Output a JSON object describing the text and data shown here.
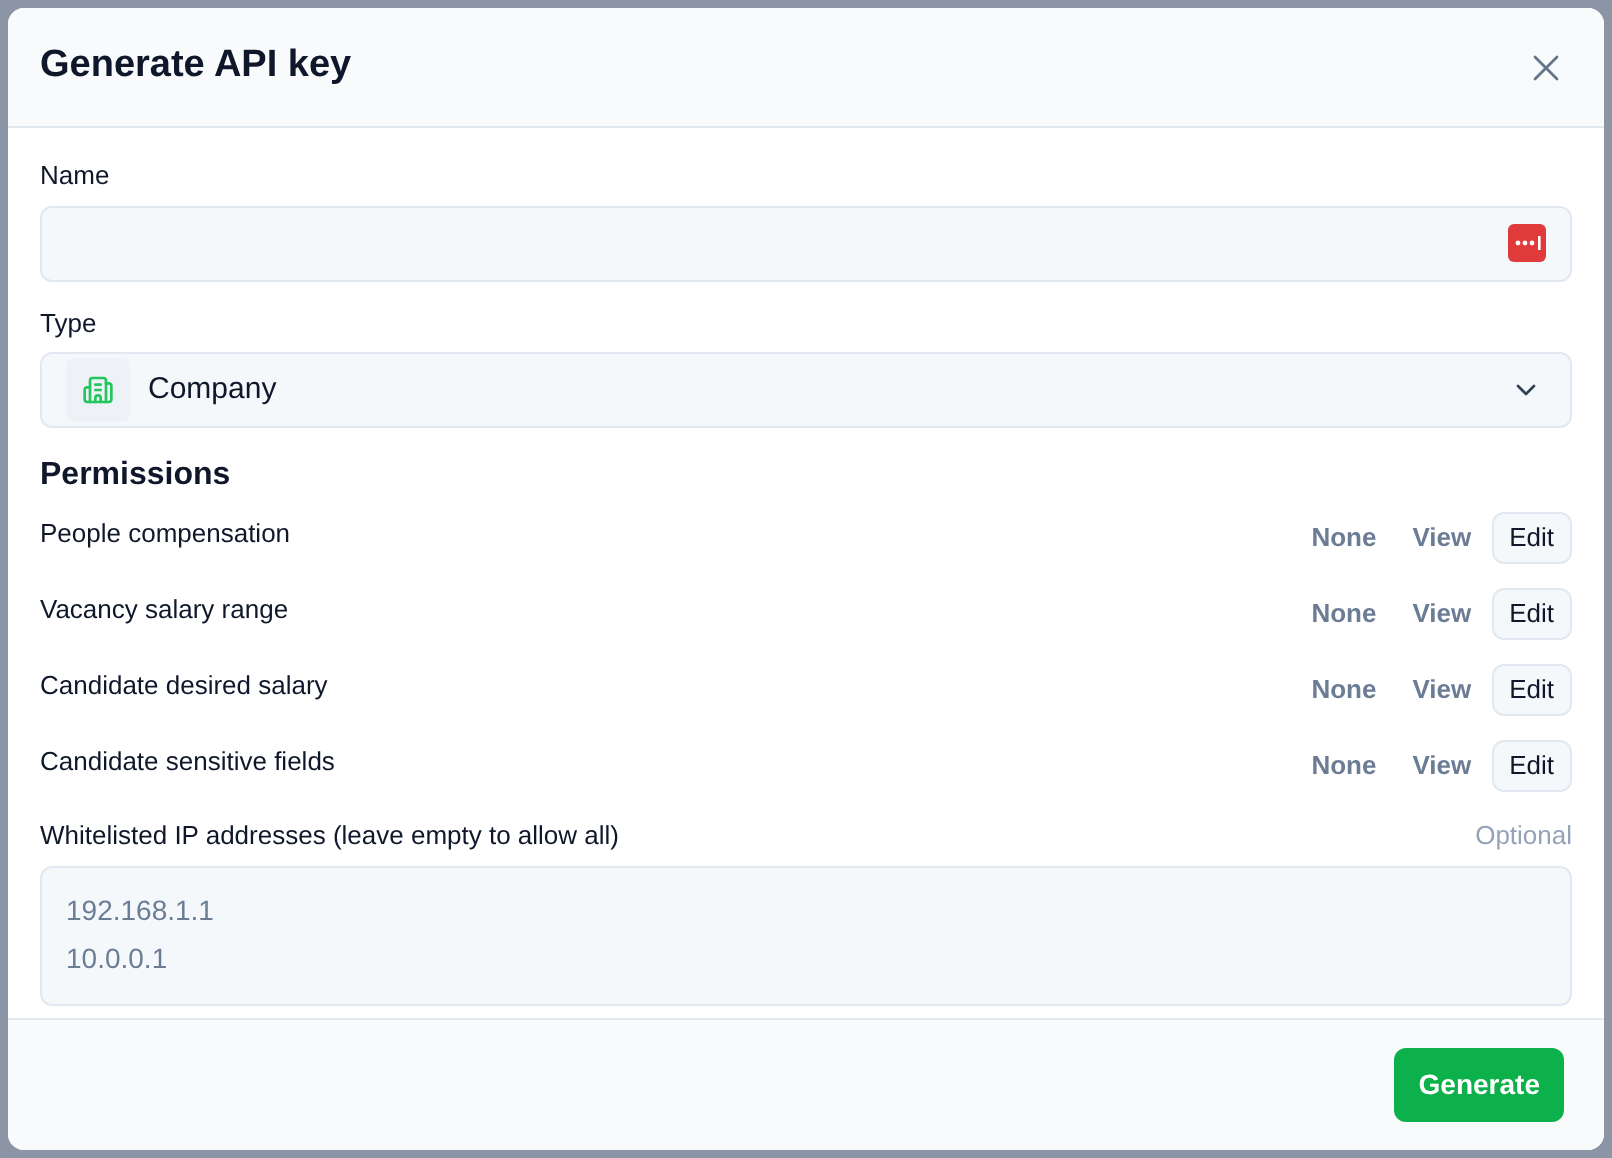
{
  "dialog": {
    "title": "Generate API key"
  },
  "name_field": {
    "label": "Name"
  },
  "type_field": {
    "label": "Type",
    "value": "Company"
  },
  "permissions": {
    "title": "Permissions",
    "rows": [
      {
        "label": "People compensation",
        "options": [
          {
            "label": "None",
            "selected": false
          },
          {
            "label": "View",
            "selected": false
          },
          {
            "label": "Edit",
            "selected": true
          }
        ]
      },
      {
        "label": "Vacancy salary range",
        "options": [
          {
            "label": "None",
            "selected": false
          },
          {
            "label": "View",
            "selected": false
          },
          {
            "label": "Edit",
            "selected": true
          }
        ]
      },
      {
        "label": "Candidate desired salary",
        "options": [
          {
            "label": "None",
            "selected": false
          },
          {
            "label": "View",
            "selected": false
          },
          {
            "label": "Edit",
            "selected": true
          }
        ]
      },
      {
        "label": "Candidate sensitive fields",
        "options": [
          {
            "label": "None",
            "selected": false
          },
          {
            "label": "View",
            "selected": false
          },
          {
            "label": "Edit",
            "selected": true
          }
        ]
      }
    ]
  },
  "ip_field": {
    "label": "Whitelisted IP addresses (leave empty to allow all)",
    "hint": "Optional",
    "placeholder": "192.168.1.1\n10.0.0.1"
  },
  "footer": {
    "button": "Generate"
  }
}
